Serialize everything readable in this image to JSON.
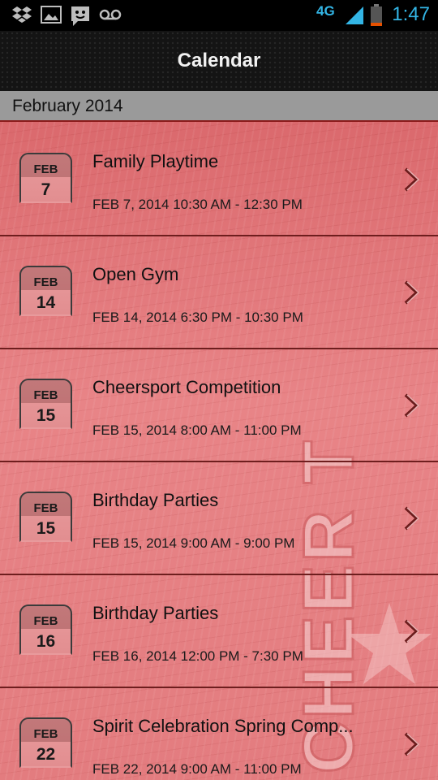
{
  "status_bar": {
    "network": "4G",
    "time": "1:47",
    "icons": [
      "dropbox-icon",
      "image-icon",
      "messaging-icon",
      "voicemail-icon",
      "signal-icon",
      "battery-icon"
    ]
  },
  "action_bar": {
    "title": "Calendar"
  },
  "calendar": {
    "month": "February 2014",
    "events": [
      {
        "month": "FEB",
        "day": "7",
        "title": "Family Playtime",
        "time": "FEB 7, 2014  10:30 AM - 12:30 PM"
      },
      {
        "month": "FEB",
        "day": "14",
        "title": "Open Gym",
        "time": "FEB 14, 2014  6:30 PM - 10:30 PM"
      },
      {
        "month": "FEB",
        "day": "15",
        "title": "Cheersport Competition",
        "time": "FEB 15, 2014  8:00 AM - 11:00 PM"
      },
      {
        "month": "FEB",
        "day": "15",
        "title": "Birthday Parties",
        "time": "FEB 15, 2014  9:00 AM - 9:00 PM"
      },
      {
        "month": "FEB",
        "day": "16",
        "title": "Birthday Parties",
        "time": "FEB 16, 2014  12:00 PM - 7:30 PM"
      },
      {
        "month": "FEB",
        "day": "22",
        "title": "Spirit Celebration Spring Comp...",
        "time": "FEB 22, 2014  9:00 AM - 11:00 PM"
      }
    ]
  },
  "watermark": {
    "text": "CHEER TEXAS"
  },
  "colors": {
    "clock": "#33b5e5",
    "content_bg": "#e0797b",
    "month_header_bg": "#9a9a9a",
    "action_bar_bg": "#141414"
  }
}
